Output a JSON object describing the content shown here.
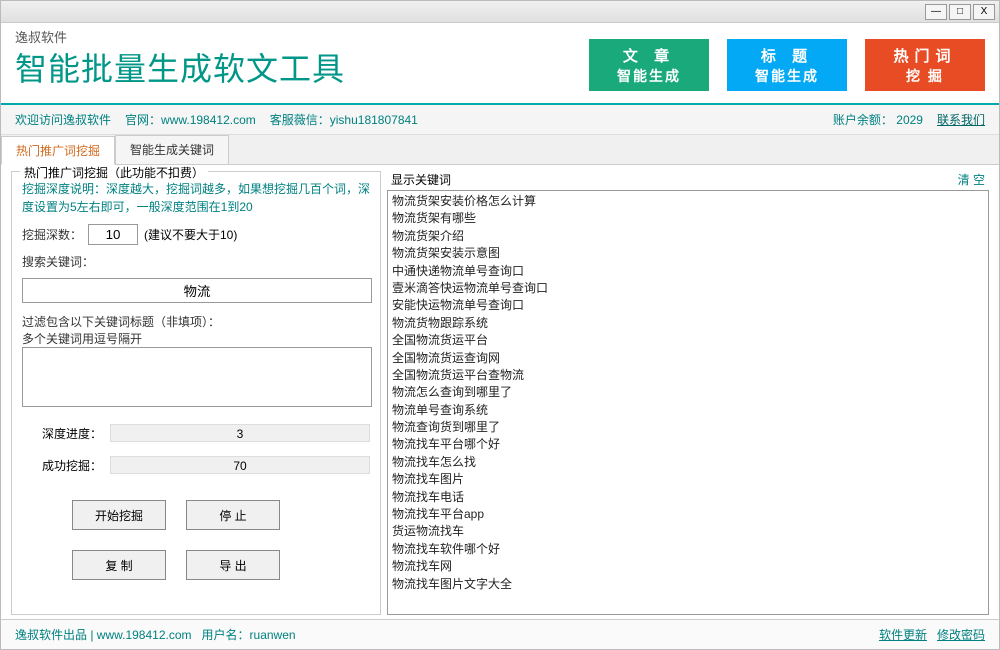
{
  "brand": {
    "small": "逸叔软件",
    "title": "智能批量生成软文工具"
  },
  "topbtns": {
    "article": {
      "l1": "文 章",
      "l2": "智能生成"
    },
    "title": {
      "l1": "标 题",
      "l2": "智能生成"
    },
    "hot": {
      "l1": "热门词",
      "l2": "挖 掘"
    }
  },
  "infobar": {
    "welcome": "欢迎访问逸叔软件",
    "site_label": "官网：",
    "site": "www.198412.com",
    "cs_label": "客服薇信：",
    "cs": "yishu181807841",
    "balance_label": "账户余额：",
    "balance": "2029",
    "contact": "联系我们"
  },
  "tabs": {
    "t1": "热门推广词挖掘",
    "t2": "智能生成关键词"
  },
  "panel": {
    "title": "热门推广词挖掘（此功能不扣费）",
    "depth_hint": "挖掘深度说明：深度越大，挖掘词越多，如果想挖掘几百个词，深度设置为5左右即可，一般深度范围在1到20",
    "depth_label": "挖掘深数：",
    "depth_value": "10",
    "depth_suggest": "(建议不要大于10)",
    "search_label": "搜索关键词：",
    "search_value": "物流",
    "filter_label": "过滤包含以下关键词标题（非填项）：",
    "filter_hint": "多个关键词用逗号隔开",
    "prog_depth_label": "深度进度：",
    "prog_depth_val": "3",
    "prog_succ_label": "成功挖掘：",
    "prog_succ_val": "70",
    "btn_start": "开始挖掘",
    "btn_stop": "停 止",
    "btn_copy": "复 制",
    "btn_export": "导 出"
  },
  "right": {
    "title": "显示关键词",
    "clear": "清 空"
  },
  "keywords": [
    "物流货架安装价格怎么计算",
    "物流货架有哪些",
    "物流货架介绍",
    "物流货架安装示意图",
    "中通快递物流单号查询口",
    "壹米滴答快运物流单号查询口",
    "安能快运物流单号查询口",
    "物流货物跟踪系统",
    "全国物流货运平台",
    "全国物流货运查询网",
    "全国物流货运平台查物流",
    "物流怎么查询到哪里了",
    "物流单号查询系统",
    "物流查询货到哪里了",
    "物流找车平台哪个好",
    "物流找车怎么找",
    "物流找车图片",
    "物流找车电话",
    "物流找车平台app",
    "货运物流找车",
    "物流找车软件哪个好",
    "物流找车网",
    "物流找车图片文字大全"
  ],
  "footer": {
    "credit": "逸叔软件出品 | www.198412.com",
    "user_label": "用户名：",
    "user": "ruanwen",
    "update": "软件更新",
    "pwd": "修改密码"
  }
}
